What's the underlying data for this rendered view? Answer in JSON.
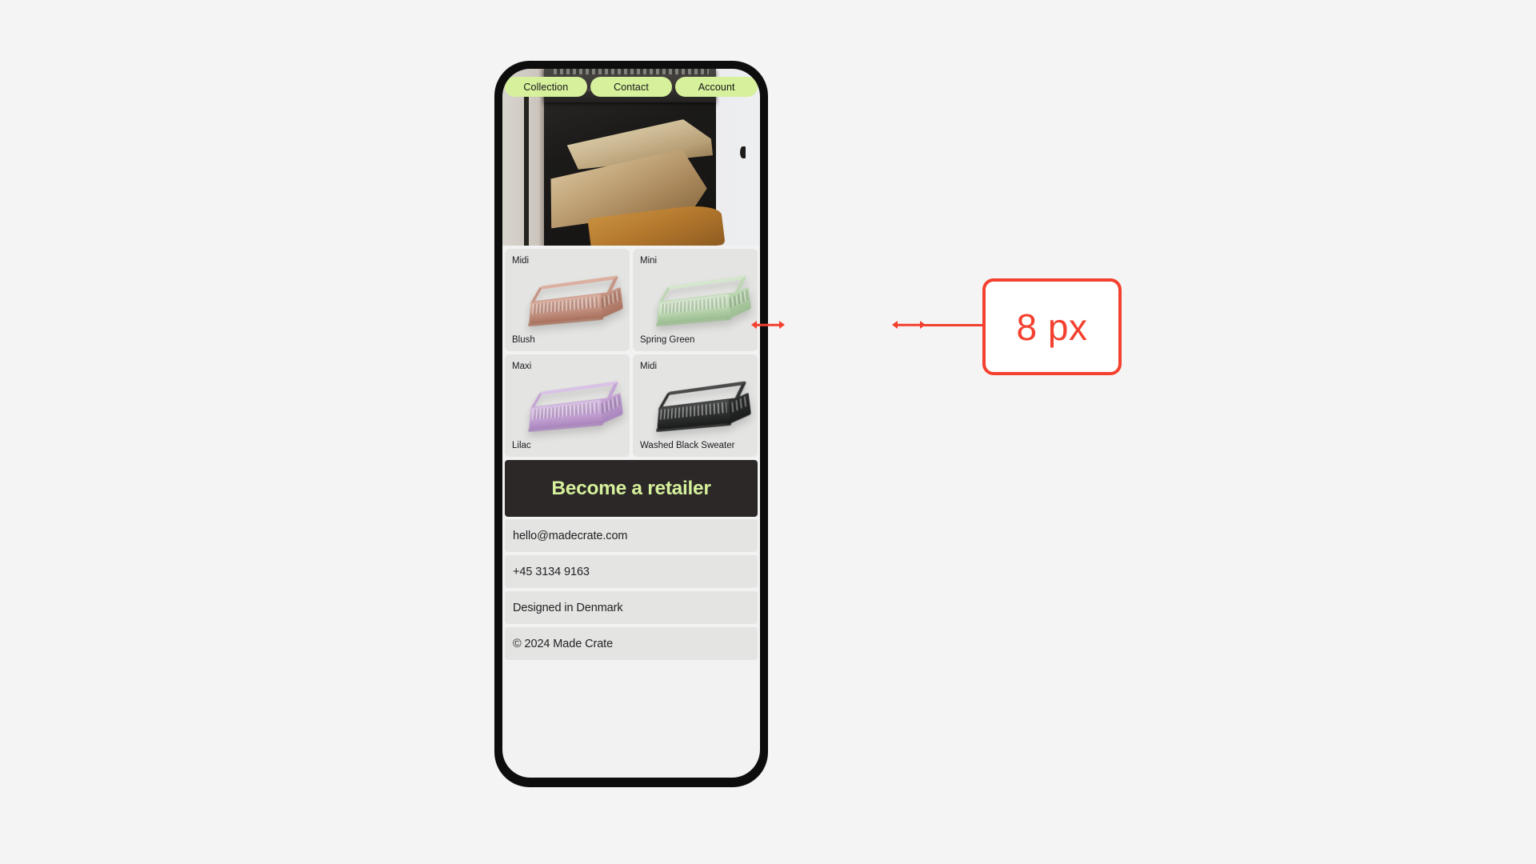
{
  "canvas": {
    "background": "#f4f4f4"
  },
  "phone": {
    "frame_color": "#0d0d0d",
    "screen_background": "#f2f2f2"
  },
  "nav": {
    "pill_color": "#d6f09b",
    "items": [
      {
        "label": "Collection",
        "name": "nav-pill-collection"
      },
      {
        "label": "Contact",
        "name": "nav-pill-contact"
      },
      {
        "label": "Account",
        "name": "nav-pill-account"
      }
    ]
  },
  "hero": {
    "alt": "firewood logs stacked inside an open dark oven"
  },
  "products": [
    {
      "size": "Midi",
      "name": "Blush",
      "color": "#c69383",
      "color_dark": "#a9735f",
      "color_light": "#dbb0a1"
    },
    {
      "size": "Mini",
      "name": "Spring Green",
      "color": "#bcd7b2",
      "color_dark": "#9cbd92",
      "color_light": "#d4e6cc"
    },
    {
      "size": "Maxi",
      "name": "Lilac",
      "color": "#c4a3d4",
      "color_dark": "#a986bd",
      "color_light": "#d9c2e5"
    },
    {
      "size": "Midi",
      "name": "Washed Black Sweater",
      "color": "#2f3030",
      "color_dark": "#1b1c1c",
      "color_light": "#4a4b4b"
    }
  ],
  "retailer": {
    "label": "Become a retailer",
    "background": "#2b2827",
    "text_color": "#d6f09b"
  },
  "footer": {
    "rows": [
      {
        "label": "hello@madecrate.com",
        "name": "footer-row-email"
      },
      {
        "label": "+45 3134 9163",
        "name": "footer-row-phone"
      },
      {
        "label": "Designed in Denmark",
        "name": "footer-row-origin"
      },
      {
        "label": "© 2024 Made Crate",
        "name": "footer-row-copyright"
      }
    ]
  },
  "annotation": {
    "value": "8 px",
    "color": "#f4402e"
  }
}
